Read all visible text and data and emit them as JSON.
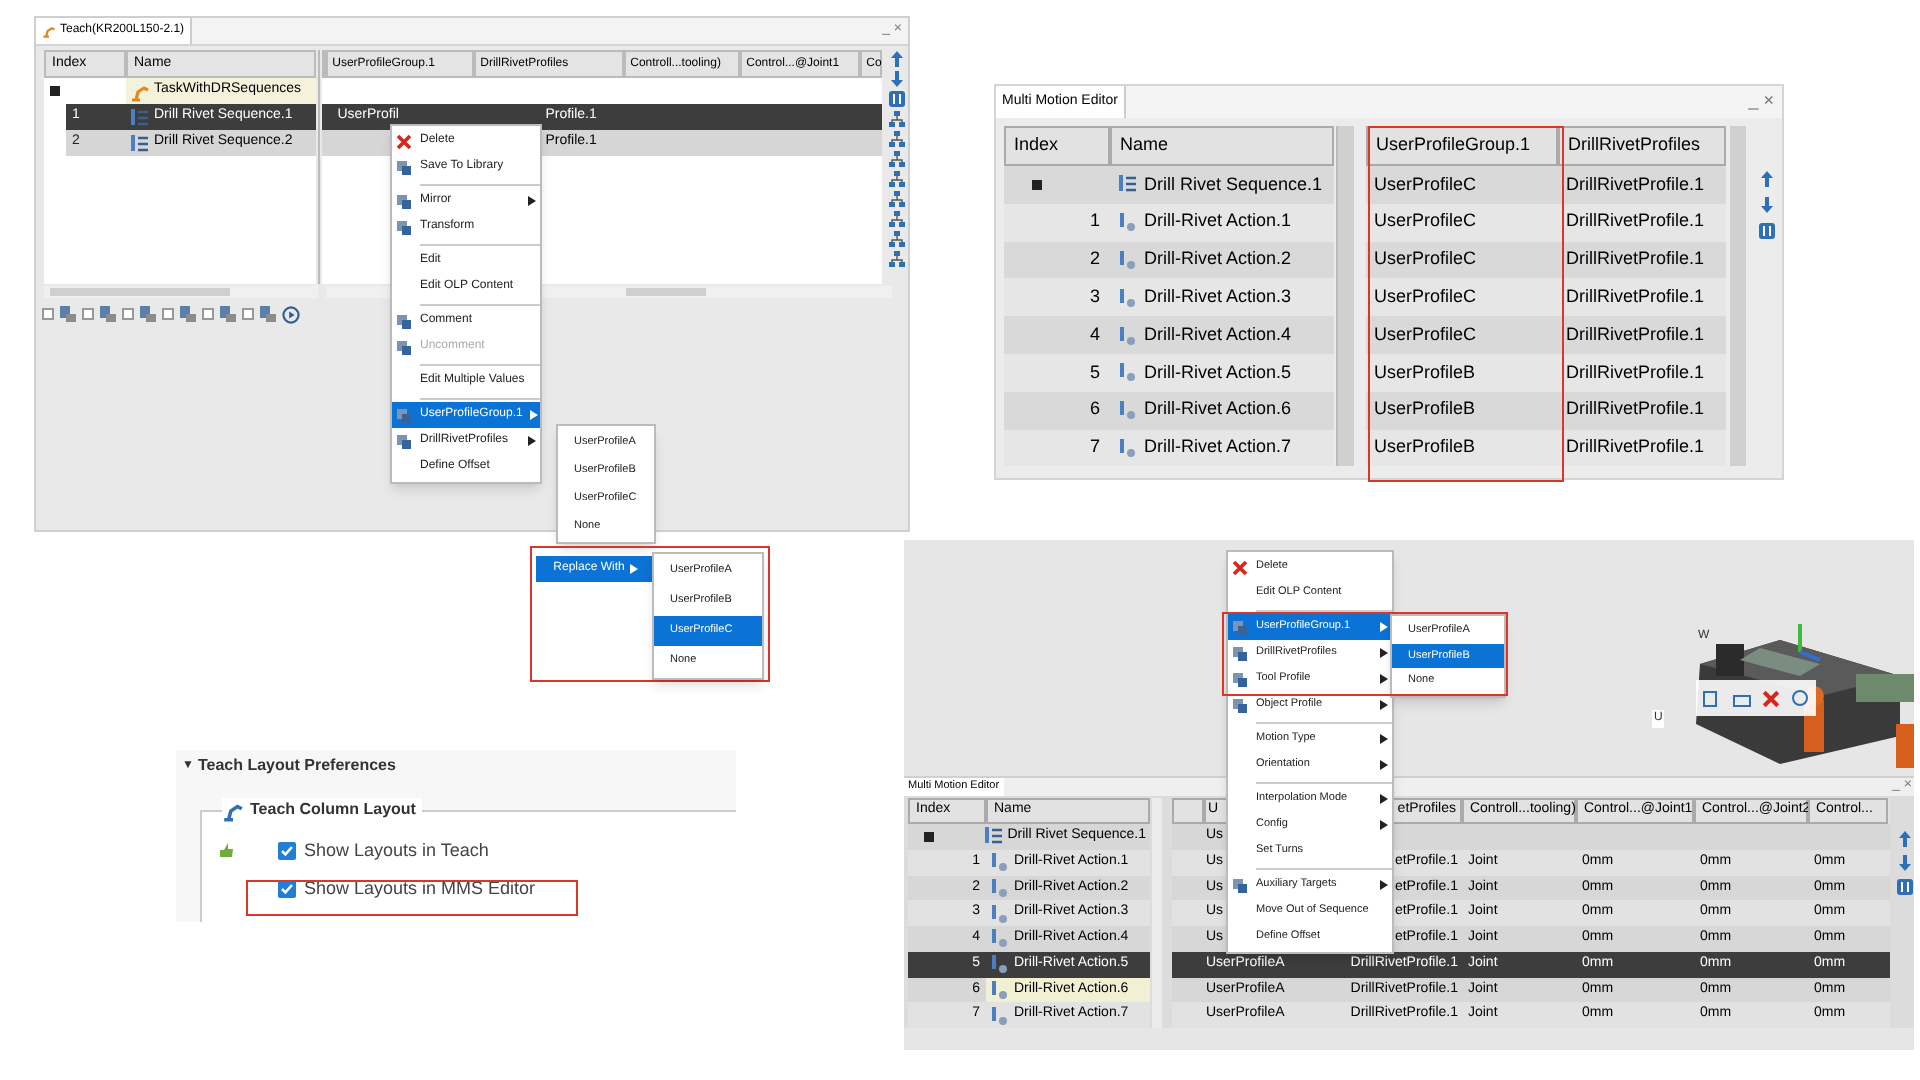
{
  "teach_window": {
    "title": "Teach(KR200L150-2.1)",
    "window_controls": "_ ×",
    "left_columns": [
      "Index",
      "Name"
    ],
    "right_columns": [
      "UserProfileGroup.1",
      "DrillRivetProfiles",
      "Controll...tooling)",
      "Control...@Joint1",
      "Co"
    ],
    "rows": [
      {
        "kind": "root",
        "name": "TaskWithDRSequences",
        "expanded": true,
        "selected": false
      },
      {
        "kind": "child",
        "index": "1",
        "name": "Drill Rivet Sequence.1",
        "group": "UserProfil",
        "profile": "Profile.1",
        "selected": true
      },
      {
        "kind": "child",
        "index": "2",
        "name": "Drill Rivet Sequence.2",
        "profile": "Profile.1",
        "selected": false
      }
    ],
    "toolbar_checkboxes": [
      {
        "checked": false
      },
      {
        "checked": false
      },
      {
        "checked": false
      },
      {
        "checked": false
      },
      {
        "checked": false
      },
      {
        "checked": false
      }
    ],
    "context_menu": [
      {
        "kind": "delete",
        "label": "Delete",
        "submenu": false,
        "selected": false,
        "disabled": false
      },
      {
        "kind": "icon",
        "label": "Save To Library",
        "submenu": false,
        "selected": false,
        "disabled": false
      },
      {
        "kind": "separator"
      },
      {
        "kind": "icon",
        "label": "Mirror",
        "submenu": true,
        "selected": false,
        "disabled": false
      },
      {
        "kind": "icon",
        "label": "Transform",
        "submenu": false,
        "selected": false,
        "disabled": false
      },
      {
        "kind": "separator"
      },
      {
        "kind": "plain",
        "label": "Edit",
        "submenu": false,
        "selected": false,
        "disabled": false
      },
      {
        "kind": "plain",
        "label": "Edit OLP Content",
        "submenu": false,
        "selected": false,
        "disabled": false
      },
      {
        "kind": "separator"
      },
      {
        "kind": "icon",
        "label": "Comment",
        "submenu": false,
        "selected": false,
        "disabled": false
      },
      {
        "kind": "icon",
        "label": "Uncomment",
        "submenu": false,
        "selected": false,
        "disabled": true
      },
      {
        "kind": "separator"
      },
      {
        "kind": "plain",
        "label": "Edit Multiple Values",
        "submenu": false,
        "selected": false,
        "disabled": false
      },
      {
        "kind": "separator"
      },
      {
        "kind": "icon",
        "label": "UserProfileGroup.1",
        "submenu": true,
        "selected": true,
        "disabled": false
      },
      {
        "kind": "icon",
        "label": "DrillRivetProfiles",
        "submenu": true,
        "selected": false,
        "disabled": false
      },
      {
        "kind": "plain",
        "label": "Define Offset",
        "submenu": false,
        "selected": false,
        "disabled": false
      }
    ],
    "profile_submenu": [
      {
        "label": "UserProfileA",
        "selected": false
      },
      {
        "label": "UserProfileB",
        "selected": false
      },
      {
        "label": "UserProfileC",
        "selected": false
      },
      {
        "label": "None",
        "selected": false
      }
    ],
    "replace_item": {
      "label": "Replace With",
      "selected": true
    },
    "replace_submenu": [
      {
        "label": "UserProfileA",
        "selected": false
      },
      {
        "label": "UserProfileB",
        "selected": false
      },
      {
        "label": "UserProfileC",
        "selected": true
      },
      {
        "label": "None",
        "selected": false
      }
    ]
  },
  "multi_motion_editor": {
    "title": "Multi Motion Editor",
    "window_controls": "_ ×",
    "left_columns": [
      "Index",
      "Name"
    ],
    "right_columns": [
      "UserProfileGroup.1",
      "DrillRivetProfiles"
    ],
    "rows": [
      {
        "kind": "root",
        "name": "Drill Rivet Sequence.1",
        "group": "UserProfileC",
        "profile": "DrillRivetProfile.1",
        "expanded": true
      },
      {
        "kind": "child",
        "index": "1",
        "name": "Drill-Rivet Action.1",
        "group": "UserProfileC",
        "profile": "DrillRivetProfile.1"
      },
      {
        "kind": "child",
        "index": "2",
        "name": "Drill-Rivet Action.2",
        "group": "UserProfileC",
        "profile": "DrillRivetProfile.1"
      },
      {
        "kind": "child",
        "index": "3",
        "name": "Drill-Rivet Action.3",
        "group": "UserProfileC",
        "profile": "DrillRivetProfile.1"
      },
      {
        "kind": "child",
        "index": "4",
        "name": "Drill-Rivet Action.4",
        "group": "UserProfileC",
        "profile": "DrillRivetProfile.1"
      },
      {
        "kind": "child",
        "index": "5",
        "name": "Drill-Rivet Action.5",
        "group": "UserProfileB",
        "profile": "DrillRivetProfile.1"
      },
      {
        "kind": "child",
        "index": "6",
        "name": "Drill-Rivet Action.6",
        "group": "UserProfileB",
        "profile": "DrillRivetProfile.1"
      },
      {
        "kind": "child",
        "index": "7",
        "name": "Drill-Rivet Action.7",
        "group": "UserProfileB",
        "profile": "DrillRivetProfile.1"
      }
    ]
  },
  "preferences": {
    "section": "▼",
    "title": "Teach Layout Preferences",
    "group_title": "Teach Column Layout",
    "options": [
      {
        "label": "Show Layouts in Teach",
        "checked": true
      },
      {
        "label": "Show Layouts in MMS Editor",
        "checked": true
      }
    ]
  },
  "viewport": {
    "context_menu": [
      {
        "kind": "delete",
        "label": "Delete",
        "submenu": false,
        "selected": false
      },
      {
        "kind": "plain",
        "label": "Edit OLP Content",
        "submenu": false,
        "selected": false
      },
      {
        "kind": "separator"
      },
      {
        "kind": "icon",
        "label": "UserProfileGroup.1",
        "submenu": true,
        "selected": true
      },
      {
        "kind": "icon",
        "label": "DrillRivetProfiles",
        "submenu": true,
        "selected": false
      },
      {
        "kind": "icon",
        "label": "Tool Profile",
        "submenu": true,
        "selected": false
      },
      {
        "kind": "icon",
        "label": "Object Profile",
        "submenu": true,
        "selected": false
      },
      {
        "kind": "separator"
      },
      {
        "kind": "plain",
        "label": "Motion Type",
        "submenu": true,
        "selected": false
      },
      {
        "kind": "plain",
        "label": "Orientation",
        "submenu": true,
        "selected": false
      },
      {
        "kind": "separator"
      },
      {
        "kind": "plain",
        "label": "Interpolation Mode",
        "submenu": true,
        "selected": false
      },
      {
        "kind": "plain",
        "label": "Config",
        "submenu": true,
        "selected": false
      },
      {
        "kind": "plain",
        "label": "Set Turns",
        "submenu": false,
        "selected": false
      },
      {
        "kind": "separator"
      },
      {
        "kind": "icon",
        "label": "Auxiliary Targets",
        "submenu": true,
        "selected": false
      },
      {
        "kind": "plain",
        "label": "Move Out of Sequence",
        "submenu": false,
        "selected": false
      },
      {
        "kind": "plain",
        "label": "Define Offset",
        "submenu": false,
        "selected": false
      }
    ],
    "profile_submenu": [
      {
        "label": "UserProfileA",
        "selected": false
      },
      {
        "label": "UserProfileB",
        "selected": true
      },
      {
        "label": "None",
        "selected": false
      }
    ],
    "axis_labels": [
      "W",
      "U"
    ]
  },
  "mms_window": {
    "title": "Multi Motion Editor",
    "window_controls": "_ ×",
    "left_columns": [
      "Index",
      "Name"
    ],
    "right_columns": [
      "U",
      "etProfiles",
      "Controll...tooling)",
      "Control...@Joint1",
      "Control...@Joint2",
      "Control..."
    ],
    "rows": [
      {
        "kind": "root",
        "name": "Drill Rivet Sequence.1",
        "group": "Us",
        "expanded": true,
        "selected": false,
        "marked": false
      },
      {
        "kind": "child",
        "index": "1",
        "name": "Drill-Rivet Action.1",
        "group": "Us",
        "profile": "etProfile.1",
        "cells": [
          "Joint",
          "0mm",
          "0mm",
          "0mm"
        ],
        "selected": false,
        "marked": false
      },
      {
        "kind": "child",
        "index": "2",
        "name": "Drill-Rivet Action.2",
        "group": "Us",
        "profile": "etProfile.1",
        "cells": [
          "Joint",
          "0mm",
          "0mm",
          "0mm"
        ],
        "selected": false,
        "marked": false
      },
      {
        "kind": "child",
        "index": "3",
        "name": "Drill-Rivet Action.3",
        "group": "Us",
        "profile": "etProfile.1",
        "cells": [
          "Joint",
          "0mm",
          "0mm",
          "0mm"
        ],
        "selected": false,
        "marked": false
      },
      {
        "kind": "child",
        "index": "4",
        "name": "Drill-Rivet Action.4",
        "group": "Us",
        "profile": "etProfile.1",
        "cells": [
          "Joint",
          "0mm",
          "0mm",
          "0mm"
        ],
        "selected": false,
        "marked": false
      },
      {
        "kind": "child",
        "index": "5",
        "name": "Drill-Rivet Action.5",
        "group": "UserProfileA",
        "profile": "DrillRivetProfile.1",
        "cells": [
          "Joint",
          "0mm",
          "0mm",
          "0mm"
        ],
        "selected": true,
        "marked": false
      },
      {
        "kind": "child",
        "index": "6",
        "name": "Drill-Rivet Action.6",
        "group": "UserProfileA",
        "profile": "DrillRivetProfile.1",
        "cells": [
          "Joint",
          "0mm",
          "0mm",
          "0mm"
        ],
        "selected": false,
        "marked": true
      },
      {
        "kind": "child",
        "index": "7",
        "name": "Drill-Rivet Action.7",
        "group": "UserProfileA",
        "profile": "DrillRivetProfile.1",
        "cells": [
          "Joint",
          "0mm",
          "0mm",
          "0mm"
        ],
        "selected": false,
        "marked": false
      }
    ]
  }
}
